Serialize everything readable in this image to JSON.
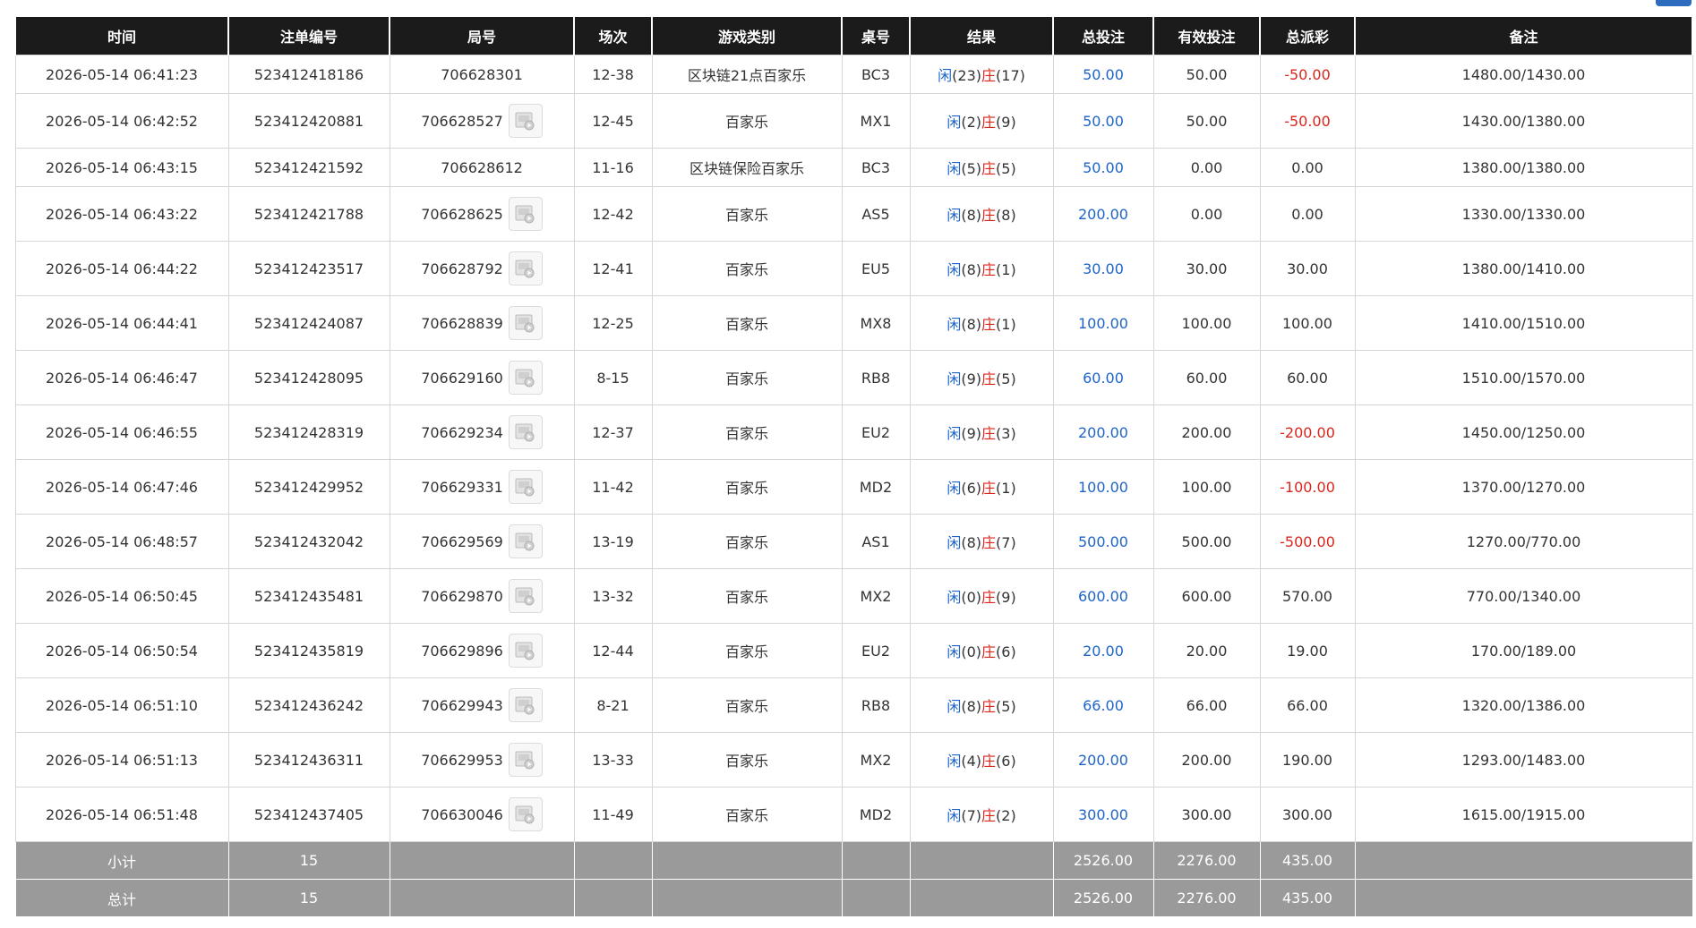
{
  "columns": [
    "时间",
    "注单编号",
    "局号",
    "场次",
    "游戏类别",
    "桌号",
    "结果",
    "总投注",
    "有效投注",
    "总派彩",
    "备注"
  ],
  "result_labels": {
    "player": "闲",
    "banker": "庄"
  },
  "rows": [
    {
      "time": "2026-05-14 06:41:23",
      "bet_id": "523412418186",
      "round": "706628301",
      "session": "12-38",
      "game": "区块链21点百家乐",
      "table": "BC3",
      "player": "(23)",
      "banker": "(17)",
      "total_bet": "50.00",
      "valid_bet": "50.00",
      "payout": "-50.00",
      "payout_negative": true,
      "note": "1480.00/1430.00",
      "has_replay": false
    },
    {
      "time": "2026-05-14 06:42:52",
      "bet_id": "523412420881",
      "round": "706628527",
      "session": "12-45",
      "game": "百家乐",
      "table": "MX1",
      "player": "(2)",
      "banker": "(9)",
      "total_bet": "50.00",
      "valid_bet": "50.00",
      "payout": "-50.00",
      "payout_negative": true,
      "note": "1430.00/1380.00",
      "has_replay": true
    },
    {
      "time": "2026-05-14 06:43:15",
      "bet_id": "523412421592",
      "round": "706628612",
      "session": "11-16",
      "game": "区块链保险百家乐",
      "table": "BC3",
      "player": "(5)",
      "banker": "(5)",
      "total_bet": "50.00",
      "valid_bet": "0.00",
      "payout": "0.00",
      "payout_negative": false,
      "note": "1380.00/1380.00",
      "has_replay": false
    },
    {
      "time": "2026-05-14 06:43:22",
      "bet_id": "523412421788",
      "round": "706628625",
      "session": "12-42",
      "game": "百家乐",
      "table": "AS5",
      "player": "(8)",
      "banker": "(8)",
      "total_bet": "200.00",
      "valid_bet": "0.00",
      "payout": "0.00",
      "payout_negative": false,
      "note": "1330.00/1330.00",
      "has_replay": true
    },
    {
      "time": "2026-05-14 06:44:22",
      "bet_id": "523412423517",
      "round": "706628792",
      "session": "12-41",
      "game": "百家乐",
      "table": "EU5",
      "player": "(8)",
      "banker": "(1)",
      "total_bet": "30.00",
      "valid_bet": "30.00",
      "payout": "30.00",
      "payout_negative": false,
      "note": "1380.00/1410.00",
      "has_replay": true
    },
    {
      "time": "2026-05-14 06:44:41",
      "bet_id": "523412424087",
      "round": "706628839",
      "session": "12-25",
      "game": "百家乐",
      "table": "MX8",
      "player": "(8)",
      "banker": "(1)",
      "total_bet": "100.00",
      "valid_bet": "100.00",
      "payout": "100.00",
      "payout_negative": false,
      "note": "1410.00/1510.00",
      "has_replay": true
    },
    {
      "time": "2026-05-14 06:46:47",
      "bet_id": "523412428095",
      "round": "706629160",
      "session": "8-15",
      "game": "百家乐",
      "table": "RB8",
      "player": "(9)",
      "banker": "(5)",
      "total_bet": "60.00",
      "valid_bet": "60.00",
      "payout": "60.00",
      "payout_negative": false,
      "note": "1510.00/1570.00",
      "has_replay": true
    },
    {
      "time": "2026-05-14 06:46:55",
      "bet_id": "523412428319",
      "round": "706629234",
      "session": "12-37",
      "game": "百家乐",
      "table": "EU2",
      "player": "(9)",
      "banker": "(3)",
      "total_bet": "200.00",
      "valid_bet": "200.00",
      "payout": "-200.00",
      "payout_negative": true,
      "note": "1450.00/1250.00",
      "has_replay": true
    },
    {
      "time": "2026-05-14 06:47:46",
      "bet_id": "523412429952",
      "round": "706629331",
      "session": "11-42",
      "game": "百家乐",
      "table": "MD2",
      "player": "(6)",
      "banker": "(1)",
      "total_bet": "100.00",
      "valid_bet": "100.00",
      "payout": "-100.00",
      "payout_negative": true,
      "note": "1370.00/1270.00",
      "has_replay": true
    },
    {
      "time": "2026-05-14 06:48:57",
      "bet_id": "523412432042",
      "round": "706629569",
      "session": "13-19",
      "game": "百家乐",
      "table": "AS1",
      "player": "(8)",
      "banker": "(7)",
      "total_bet": "500.00",
      "valid_bet": "500.00",
      "payout": "-500.00",
      "payout_negative": true,
      "note": "1270.00/770.00",
      "has_replay": true
    },
    {
      "time": "2026-05-14 06:50:45",
      "bet_id": "523412435481",
      "round": "706629870",
      "session": "13-32",
      "game": "百家乐",
      "table": "MX2",
      "player": "(0)",
      "banker": "(9)",
      "total_bet": "600.00",
      "valid_bet": "600.00",
      "payout": "570.00",
      "payout_negative": false,
      "note": "770.00/1340.00",
      "has_replay": true
    },
    {
      "time": "2026-05-14 06:50:54",
      "bet_id": "523412435819",
      "round": "706629896",
      "session": "12-44",
      "game": "百家乐",
      "table": "EU2",
      "player": "(0)",
      "banker": "(6)",
      "total_bet": "20.00",
      "valid_bet": "20.00",
      "payout": "19.00",
      "payout_negative": false,
      "note": "170.00/189.00",
      "has_replay": true
    },
    {
      "time": "2026-05-14 06:51:10",
      "bet_id": "523412436242",
      "round": "706629943",
      "session": "8-21",
      "game": "百家乐",
      "table": "RB8",
      "player": "(8)",
      "banker": "(5)",
      "total_bet": "66.00",
      "valid_bet": "66.00",
      "payout": "66.00",
      "payout_negative": false,
      "note": "1320.00/1386.00",
      "has_replay": true
    },
    {
      "time": "2026-05-14 06:51:13",
      "bet_id": "523412436311",
      "round": "706629953",
      "session": "13-33",
      "game": "百家乐",
      "table": "MX2",
      "player": "(4)",
      "banker": "(6)",
      "total_bet": "200.00",
      "valid_bet": "200.00",
      "payout": "190.00",
      "payout_negative": false,
      "note": "1293.00/1483.00",
      "has_replay": true
    },
    {
      "time": "2026-05-14 06:51:48",
      "bet_id": "523412437405",
      "round": "706630046",
      "session": "11-49",
      "game": "百家乐",
      "table": "MD2",
      "player": "(7)",
      "banker": "(2)",
      "total_bet": "300.00",
      "valid_bet": "300.00",
      "payout": "300.00",
      "payout_negative": false,
      "note": "1615.00/1915.00",
      "has_replay": true
    }
  ],
  "subtotal": {
    "label": "小计",
    "count": "15",
    "total_bet": "2526.00",
    "valid_bet": "2276.00",
    "payout": "435.00"
  },
  "grand_total": {
    "label": "总计",
    "count": "15",
    "total_bet": "2526.00",
    "valid_bet": "2276.00",
    "payout": "435.00"
  },
  "icons": {
    "replay": "replay-video-icon",
    "corner": "top-right-button"
  },
  "colors": {
    "header_bg": "#1b1b1b",
    "footer_bg": "#9a9a9a",
    "blue": "#1e64c8",
    "red": "#d9261c"
  }
}
